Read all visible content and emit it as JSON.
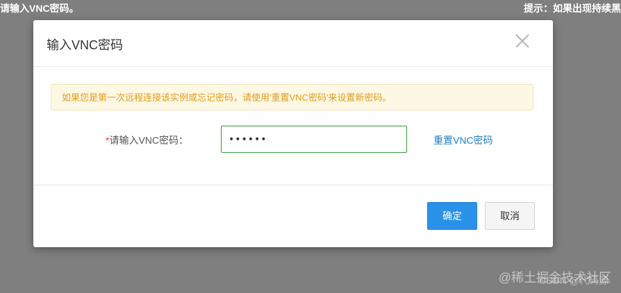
{
  "background": {
    "left_text": "请输入VNC密码。",
    "right_text": "提示：如果出现持续黑"
  },
  "dialog": {
    "title": "输入VNC密码",
    "close_icon": "close-icon",
    "alert_text": "如果您是第一次远程连接该实例或忘记密码，请使用'重置VNC密码'来设置新密码。",
    "field": {
      "required_mark": "*",
      "label": "请输入VNC密码：",
      "value": "••••••",
      "placeholder": ""
    },
    "reset_link": "重置VNC密码",
    "confirm_label": "确定",
    "cancel_label": "取消"
  },
  "watermark": {
    "line1": "@稀土掘金技术社区",
    "line2": "CSDN @代码源"
  },
  "colors": {
    "primary": "#2a91e8",
    "link": "#1f7ec4",
    "alert_text": "#e39b1a",
    "input_border": "#2d9a3a"
  }
}
